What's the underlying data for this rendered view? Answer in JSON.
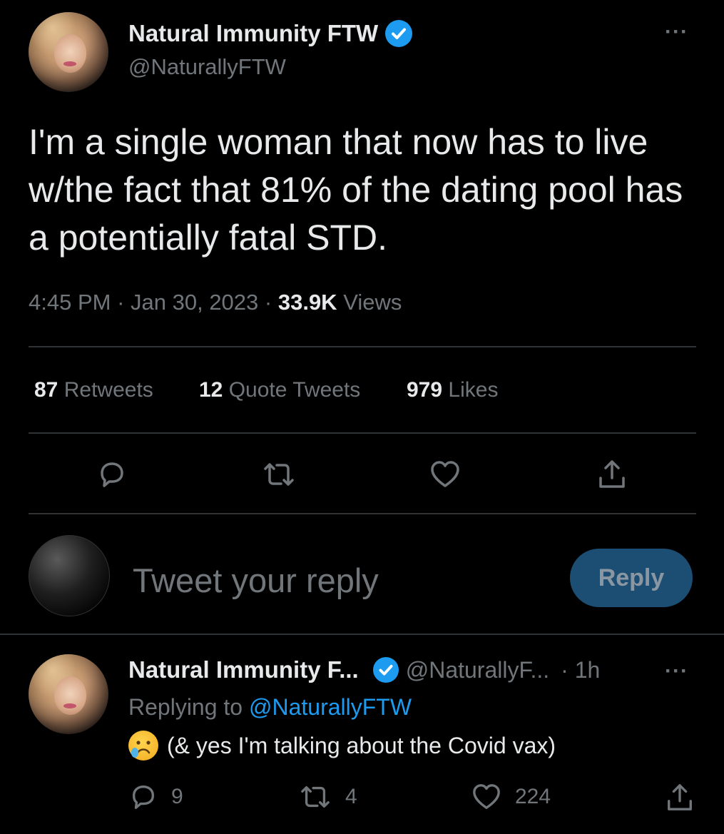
{
  "tweet": {
    "author_name": "Natural Immunity FTW",
    "author_handle": "@NaturallyFTW",
    "text": "I'm a single woman that now has to live w/the fact that 81% of the dating pool has a potentially fatal STD.",
    "time": "4:45 PM",
    "date": "Jan 30, 2023",
    "views_count": "33.9K",
    "views_label": "Views",
    "retweets_count": "87",
    "retweets_label": "Retweets",
    "quotes_count": "12",
    "quotes_label": "Quote Tweets",
    "likes_count": "979",
    "likes_label": "Likes",
    "more_label": "···"
  },
  "composer": {
    "placeholder": "Tweet your reply",
    "button_label": "Reply"
  },
  "reply": {
    "author_name": "Natural Immunity F...",
    "author_handle": "@NaturallyF...",
    "age": "· 1h",
    "replying_prefix": "Replying to",
    "replying_handle": "@NaturallyFTW",
    "text": "(& yes I'm talking about the Covid vax)",
    "emoji": "crying-face",
    "reply_count": "9",
    "retweet_count": "4",
    "like_count": "224",
    "more_label": "···"
  },
  "colors": {
    "background": "#000000",
    "text": "#e7e9ea",
    "muted": "#71767b",
    "accent": "#1d9bf0",
    "divider": "#2f3336",
    "reply_button_bg": "#1c4e73"
  },
  "icons": [
    "comment-icon",
    "retweet-icon",
    "heart-icon",
    "share-icon",
    "verified-badge-icon",
    "more-icon"
  ]
}
